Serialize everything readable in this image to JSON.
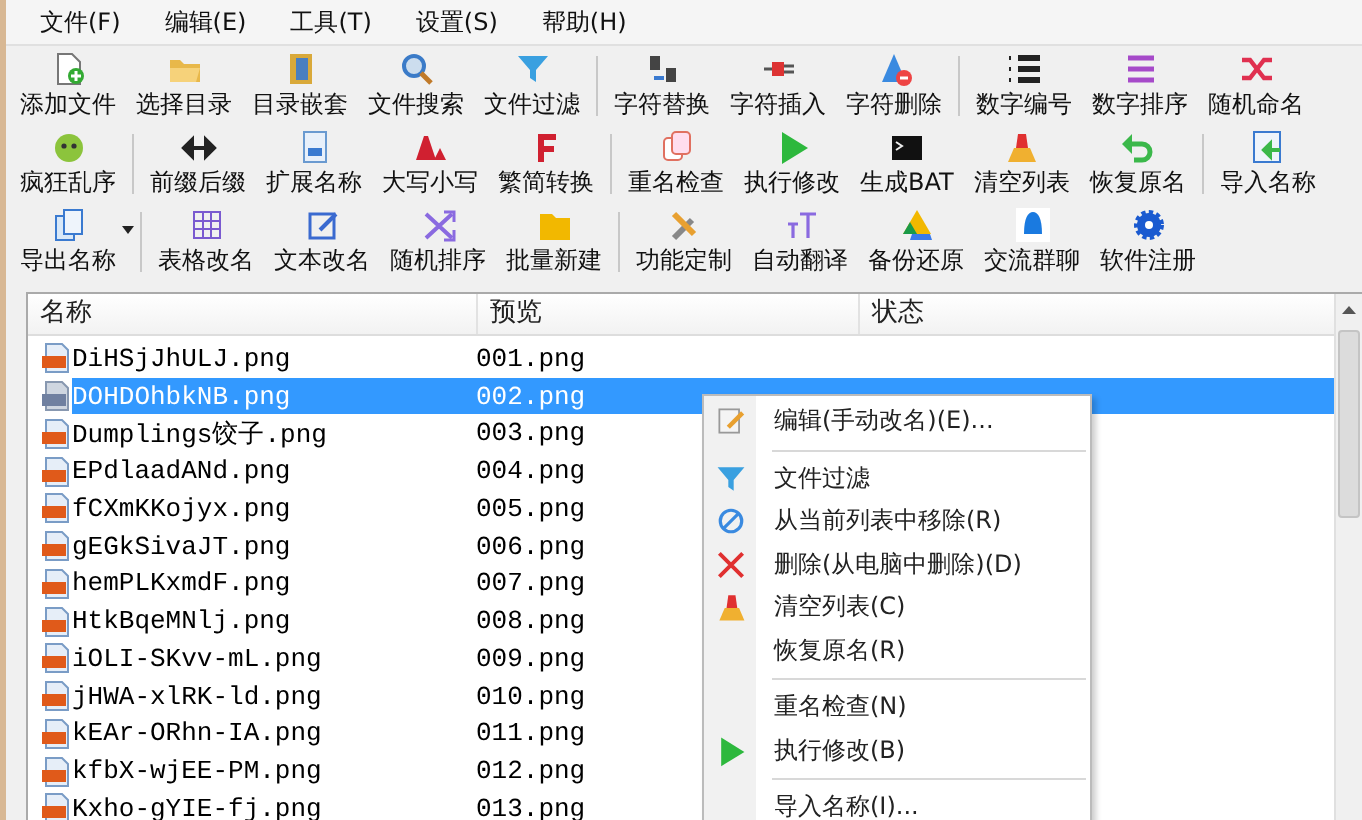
{
  "menubar": [
    "文件(F)",
    "编辑(E)",
    "工具(T)",
    "设置(S)",
    "帮助(H)"
  ],
  "toolbars": [
    {
      "groups": [
        [
          {
            "label": "添加文件",
            "dropdown": false
          },
          {
            "label": "选择目录",
            "dropdown": false
          },
          {
            "label": "目录嵌套",
            "dropdown": false
          },
          {
            "label": "文件搜索",
            "dropdown": false
          },
          {
            "label": "文件过滤",
            "dropdown": false
          }
        ],
        [
          {
            "label": "字符替换",
            "dropdown": false
          },
          {
            "label": "字符插入",
            "dropdown": false
          },
          {
            "label": "字符删除",
            "dropdown": false
          }
        ],
        [
          {
            "label": "数字编号",
            "dropdown": false
          },
          {
            "label": "数字排序",
            "dropdown": false
          },
          {
            "label": "随机命名",
            "dropdown": false
          }
        ]
      ]
    },
    {
      "groups": [
        [
          {
            "label": "疯狂乱序",
            "dropdown": false
          }
        ],
        [
          {
            "label": "前缀后缀",
            "dropdown": false
          },
          {
            "label": "扩展名称",
            "dropdown": false
          },
          {
            "label": "大写小写",
            "dropdown": false
          },
          {
            "label": "繁简转换",
            "dropdown": false
          }
        ],
        [
          {
            "label": "重名检查",
            "dropdown": false
          },
          {
            "label": "执行修改",
            "dropdown": false
          },
          {
            "label": "生成BAT",
            "dropdown": false
          },
          {
            "label": "清空列表",
            "dropdown": false
          },
          {
            "label": "恢复原名",
            "dropdown": false
          }
        ],
        [
          {
            "label": "导入名称",
            "dropdown": false
          }
        ]
      ]
    },
    {
      "groups": [
        [
          {
            "label": "导出名称",
            "dropdown": true
          }
        ],
        [
          {
            "label": "表格改名",
            "dropdown": false
          },
          {
            "label": "文本改名",
            "dropdown": false
          },
          {
            "label": "随机排序",
            "dropdown": false
          },
          {
            "label": "批量新建",
            "dropdown": false
          }
        ],
        [
          {
            "label": "功能定制",
            "dropdown": false
          },
          {
            "label": "自动翻译",
            "dropdown": false
          },
          {
            "label": "备份还原",
            "dropdown": false
          },
          {
            "label": "交流群聊",
            "dropdown": false
          },
          {
            "label": "软件注册",
            "dropdown": false
          }
        ]
      ]
    }
  ],
  "table": {
    "columns": [
      "名称",
      "预览",
      "状态"
    ],
    "rows": [
      {
        "name": "DiHSjJhULJ.png",
        "preview": "001.png",
        "selected": false
      },
      {
        "name": "DOHDOhbkNB.png",
        "preview": "002.png",
        "selected": true
      },
      {
        "name": "Dumplings饺子.png",
        "preview": "003.png",
        "selected": false
      },
      {
        "name": "EPdlaadANd.png",
        "preview": "004.png",
        "selected": false
      },
      {
        "name": "fCXmKKojyx.png",
        "preview": "005.png",
        "selected": false
      },
      {
        "name": "gEGkSivaJT.png",
        "preview": "006.png",
        "selected": false
      },
      {
        "name": "hemPLKxmdF.png",
        "preview": "007.png",
        "selected": false
      },
      {
        "name": "HtkBqeMNlj.png",
        "preview": "008.png",
        "selected": false
      },
      {
        "name": "iOLI-SKvv-mL.png",
        "preview": "009.png",
        "selected": false
      },
      {
        "name": "jHWA-xlRK-ld.png",
        "preview": "010.png",
        "selected": false
      },
      {
        "name": "kEAr-ORhn-IA.png",
        "preview": "011.png",
        "selected": false
      },
      {
        "name": "kfbX-wjEE-PM.png",
        "preview": "012.png",
        "selected": false
      },
      {
        "name": "Kxho-gYIE-fj.png",
        "preview": "013.png",
        "selected": false
      }
    ]
  },
  "context_menu": {
    "groups": [
      [
        "编辑(手动改名)(E)..."
      ],
      [
        "文件过滤",
        "从当前列表中移除(R)",
        "删除(从电脑中删除)(D)",
        "清空列表(C)",
        "恢复原名(R)"
      ],
      [
        "重名检查(N)",
        "执行修改(B)"
      ],
      [
        "导入名称(I)..."
      ]
    ]
  }
}
